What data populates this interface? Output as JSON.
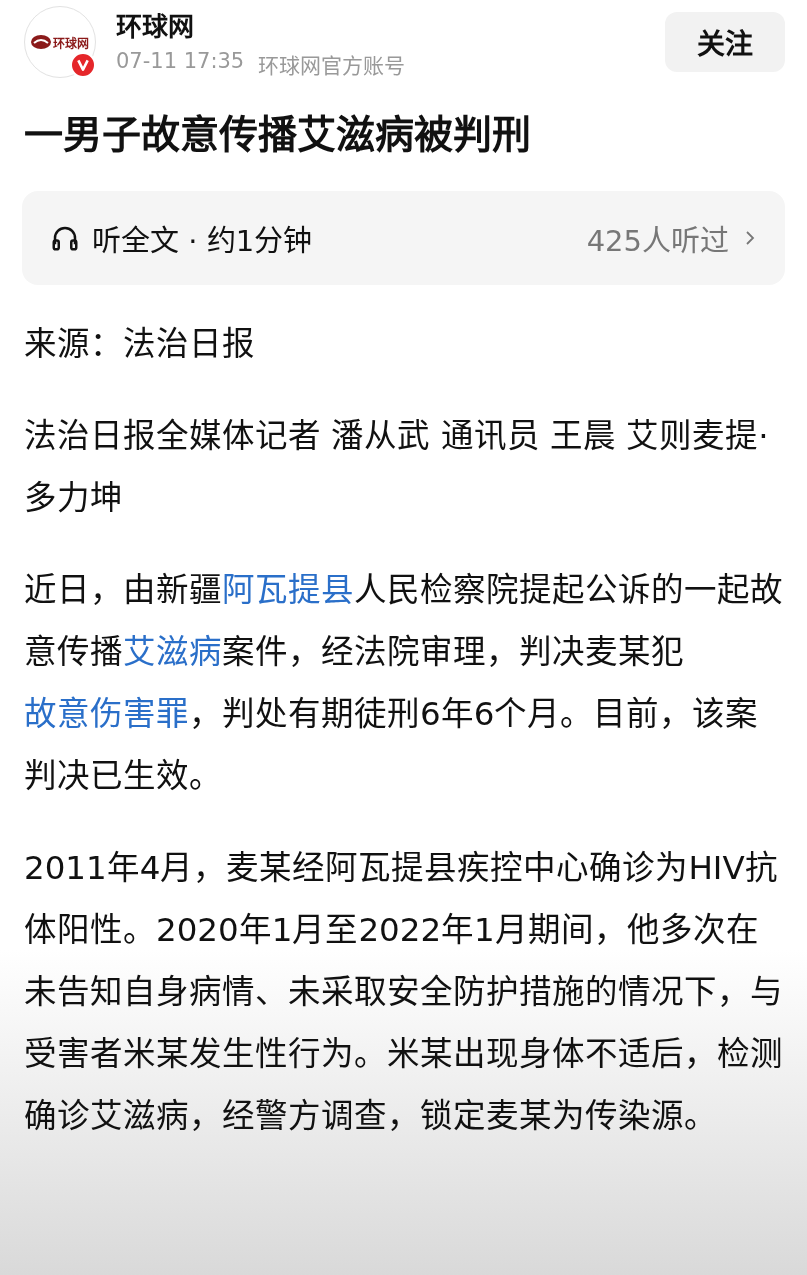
{
  "author": {
    "logo_text": "环球网",
    "verified": true,
    "name": "环球网",
    "time": "07-11 17:35",
    "account": "环球网官方账号"
  },
  "follow_button": {
    "label": "关注"
  },
  "title": "一男子故意传播艾滋病被判刑",
  "listen": {
    "label": "听全文 · 约1分钟",
    "count": "425人听过"
  },
  "paragraphs": [
    [
      {
        "text": "来源：法治日报",
        "link": false
      }
    ],
    [
      {
        "text": "法治日报全媒体记者 潘从武 通讯员 王晨 艾则麦提·多力坤",
        "link": false
      }
    ],
    [
      {
        "text": "近日，由新疆",
        "link": false
      },
      {
        "text": "阿瓦提县",
        "link": true
      },
      {
        "text": "人民检察院提起公诉的一起故意传播",
        "link": false
      },
      {
        "text": "艾滋病",
        "link": true
      },
      {
        "text": "案件，经法院审理，判决麦某犯",
        "link": false
      },
      {
        "text": "故意伤害罪",
        "link": true
      },
      {
        "text": "，判处有期徒刑6年6个月。目前，该案判决已生效。",
        "link": false
      }
    ],
    [
      {
        "text": "2011年4月，麦某经阿瓦提县疾控中心确诊为HIV抗体阳性。2020年1月至2022年1月期间，他多次在未告知自身病情、未采取安全防护措施的情况下，与受害者米某发生性行为。米某出现身体不适后，检测确诊艾滋病，经警方调查，锁定麦某为传染源。",
        "link": false
      }
    ]
  ]
}
